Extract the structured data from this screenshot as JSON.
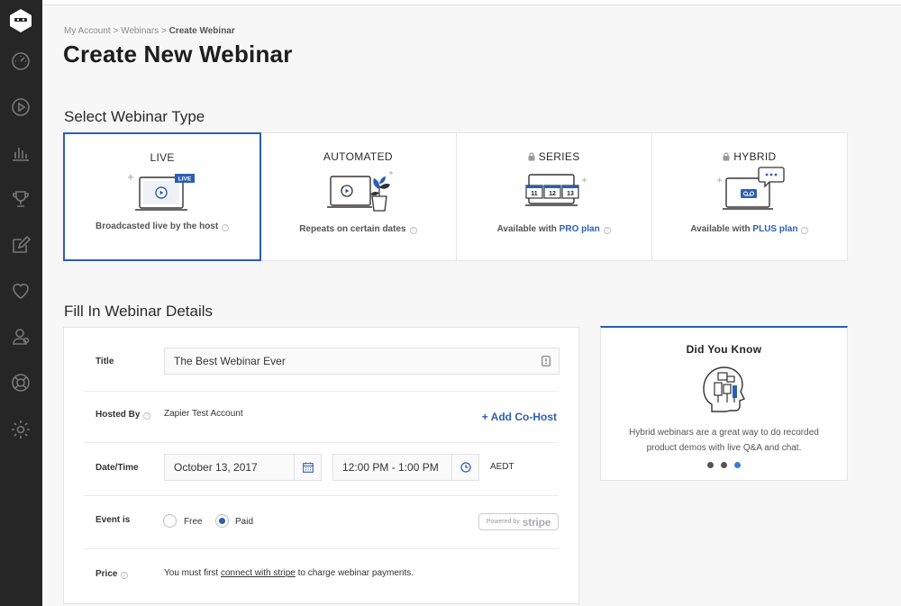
{
  "nav": {
    "logo": "logo-icon",
    "items": [
      "dashboard-icon",
      "play-icon",
      "analytics-icon",
      "trophy-icon",
      "edit-icon",
      "heart-icon",
      "users-icon",
      "support-icon",
      "settings-icon"
    ]
  },
  "breadcrumb": {
    "item1": "My Account",
    "sep": ">",
    "item2": "Webinars",
    "current": "Create Webinar"
  },
  "page_title": "Create New Webinar",
  "type_section_title": "Select Webinar Type",
  "webinar_types": [
    {
      "name": "LIVE",
      "desc": "Broadcasted live by the host",
      "locked": false,
      "selected": true,
      "badge": "LIVE"
    },
    {
      "name": "AUTOMATED",
      "desc": "Repeats on certain dates",
      "locked": false,
      "selected": false
    },
    {
      "name": "SERIES",
      "desc_prefix": "Available with",
      "plan": "PRO plan",
      "locked": true,
      "selected": false,
      "dates": [
        "11",
        "12",
        "13"
      ]
    },
    {
      "name": "HYBRID",
      "desc_prefix": "Available with",
      "plan": "PLUS plan",
      "locked": true,
      "selected": false
    }
  ],
  "details_section_title": "Fill In Webinar Details",
  "form": {
    "title_label": "Title",
    "title_value": "The Best Webinar Ever",
    "hosted_label": "Hosted By",
    "hosted_value": "Zapier Test Account",
    "add_cohost": "+ Add Co-Host",
    "datetime_label": "Date/Time",
    "date_value": "October 13, 2017",
    "time_value": "12:00 PM - 1:00 PM",
    "timezone": "AEDT",
    "event_label": "Event is",
    "free_label": "Free",
    "paid_label": "Paid",
    "selected_option": "Paid",
    "stripe_powered": "Powered by",
    "stripe_brand": "stripe",
    "price_label": "Price",
    "price_text_before": "You must first",
    "price_link": "connect with stripe",
    "price_text_after": "to charge webinar payments."
  },
  "did_you_know": {
    "title": "Did You Know",
    "text": "Hybrid webinars are a great way to do recorded product demos with live Q&A and chat.",
    "slide_count": 3,
    "active_slide": 3
  },
  "colors": {
    "accent": "#2c5fb3",
    "sidebar": "#262626",
    "background": "#f7f7f8"
  }
}
